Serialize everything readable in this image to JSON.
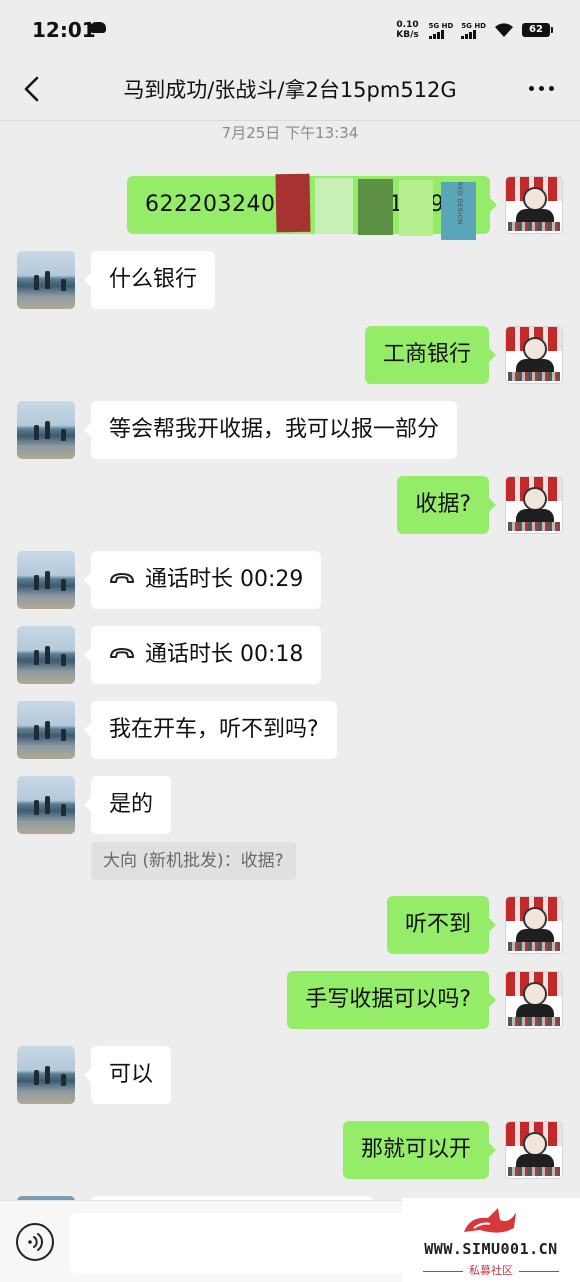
{
  "status_bar": {
    "time": "12:01",
    "net_speed_value": "0.10",
    "net_speed_unit": "KB/s",
    "sim1": "5G HD",
    "sim2": "5G HD",
    "battery": "62"
  },
  "header": {
    "title": "马到成功/张战斗/拿2台15pm512G"
  },
  "timestamp": "7月25日 下午13:34",
  "messages": [
    {
      "side": "right",
      "text": "622203240",
      "text_tail": "0",
      "text_tail2": "1",
      "text_tail3": "9",
      "redacted": true,
      "tag": "RED DESIGN"
    },
    {
      "side": "left",
      "text": "什么银行"
    },
    {
      "side": "right",
      "text": "工商银行"
    },
    {
      "side": "left",
      "text": "等会帮我开收据，我可以报一部分"
    },
    {
      "side": "right",
      "text": "收据?"
    },
    {
      "side": "left",
      "type": "call",
      "text": "通话时长 00:29"
    },
    {
      "side": "left",
      "type": "call",
      "text": "通话时长 00:18"
    },
    {
      "side": "left",
      "text": "我在开车，听不到吗?"
    },
    {
      "side": "left",
      "text": "是的",
      "quote": "大向 (新机批发)：收据?"
    },
    {
      "side": "right",
      "text": "听不到"
    },
    {
      "side": "right",
      "text": "手写收据可以吗?"
    },
    {
      "side": "left",
      "text": "可以"
    },
    {
      "side": "right",
      "text": "那就可以开"
    }
  ],
  "input": {
    "value": "",
    "placeholder": ""
  },
  "watermark": {
    "url": "WWW.SIMU001.CN",
    "subtitle": "私募社区"
  },
  "colors": {
    "background": "#ededed",
    "bubble_self": "#95ec69",
    "bubble_other": "#ffffff",
    "timestamp": "#8a8a8a"
  },
  "icons": {
    "back": "chevron-left-icon",
    "more": "more-dots-icon",
    "call": "phone-handset-icon",
    "voice": "voice-input-icon"
  }
}
